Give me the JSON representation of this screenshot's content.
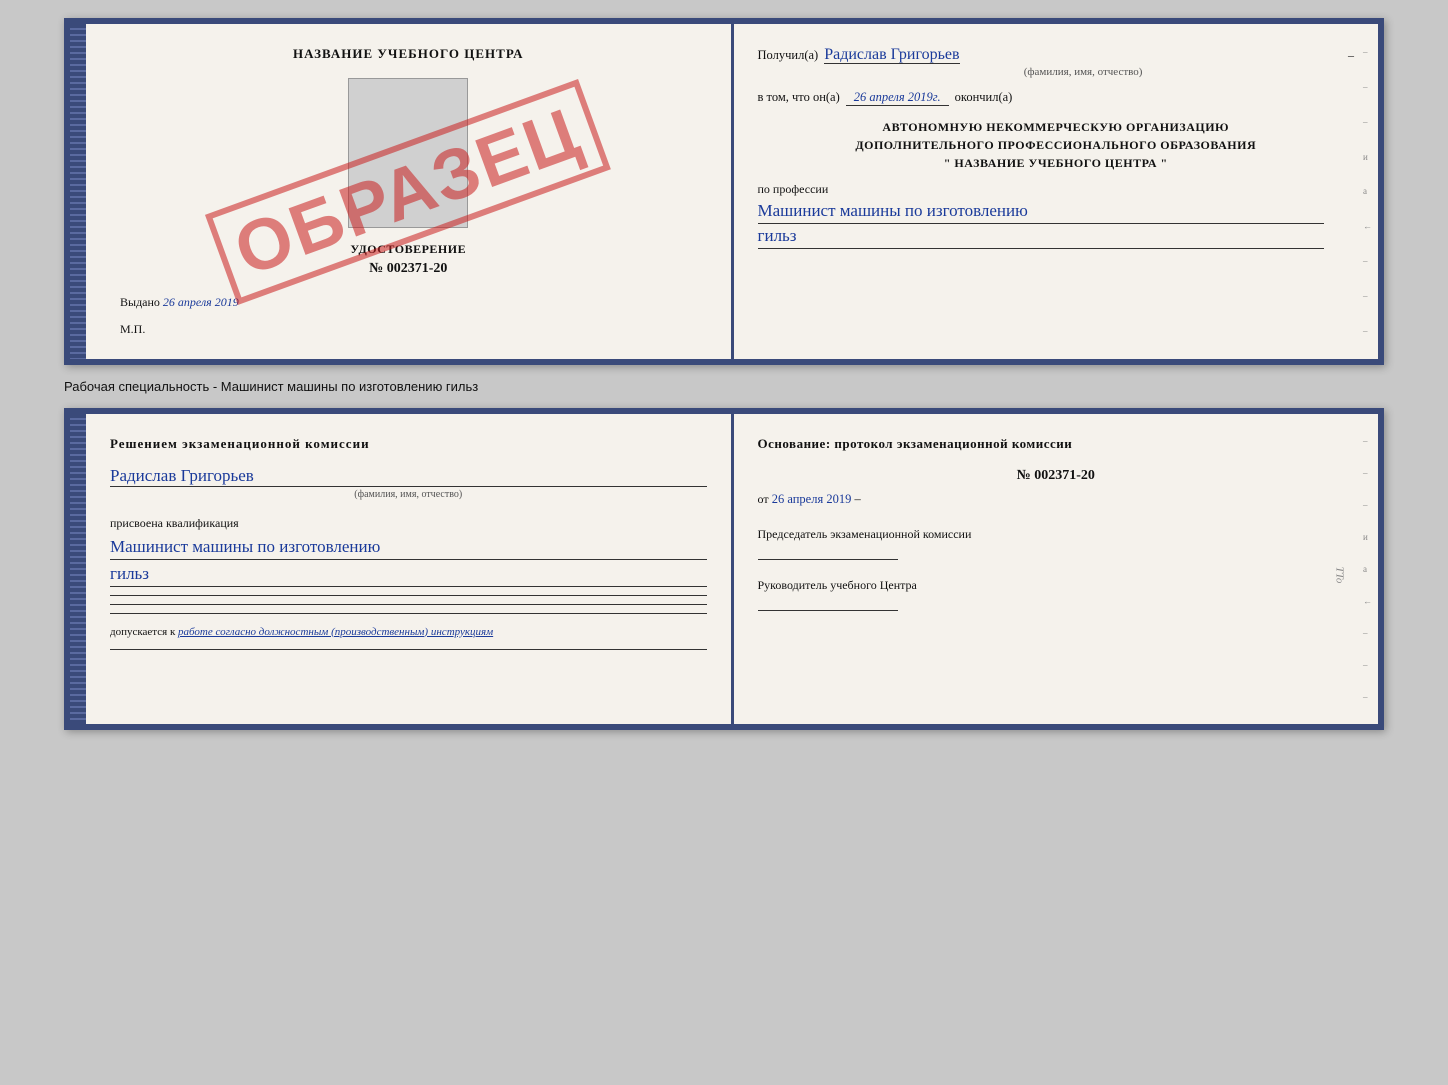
{
  "topCard": {
    "left": {
      "title": "НАЗВАНИЕ УЧЕБНОГО ЦЕНТРА",
      "udost_label": "УДОСТОВЕРЕНИЕ",
      "number": "№ 002371-20",
      "vydano_label": "Выдано",
      "vydano_date": "26 апреля 2019",
      "mp_label": "М.П.",
      "stamp": "ОБРАЗЕЦ"
    },
    "right": {
      "poluchil_label": "Получил(а)",
      "poluchil_name": "Радислав Григорьев",
      "poluchil_sub": "(фамилия, имя, отчество)",
      "vtom_label": "в том, что он(а)",
      "vtom_date": "26 апреля 2019г.",
      "okончил_label": "окончил(а)",
      "block1_line1": "АВТОНОМНУЮ НЕКОММЕРЧЕСКУЮ ОРГАНИЗАЦИЮ",
      "block1_line2": "ДОПОЛНИТЕЛЬНОГО ПРОФЕССИОНАЛЬНОГО ОБРАЗОВАНИЯ",
      "block1_line3": "\"  НАЗВАНИЕ УЧЕБНОГО ЦЕНТРА  \"",
      "po_professii_label": "по профессии",
      "profession_line1": "Машинист машины по изготовлению",
      "profession_line2": "гильз",
      "edge_marks": [
        "-",
        "-",
        "-",
        "-",
        "и",
        "а",
        "←",
        "-",
        "-",
        "-"
      ]
    }
  },
  "caption": {
    "text": "Рабочая специальность - Машинист машины по изготовлению гильз"
  },
  "bottomCard": {
    "left": {
      "heading": "Решением  экзаменационной  комиссии",
      "person_name": "Радислав Григорьев",
      "person_name_sub": "(фамилия, имя, отчество)",
      "assigned_label": "присвоена квалификация",
      "assigned_value_line1": "Машинист машины по изготовлению",
      "assigned_value_line2": "гильз",
      "dopusk_prefix": "допускается к",
      "dopusk_italic": "работе согласно должностным (производственным) инструкциям"
    },
    "right": {
      "heading": "Основание: протокол экзаменационной  комиссии",
      "number": "№  002371-20",
      "date_prefix": "от",
      "date_value": "26 апреля 2019",
      "predsedatel_label": "Председатель экзаменационной комиссии",
      "rukovoditel_label": "Руководитель учебного Центра",
      "edge_marks": [
        "-",
        "-",
        "-",
        "-",
        "и",
        "а",
        "←",
        "-",
        "-",
        "-"
      ]
    }
  }
}
